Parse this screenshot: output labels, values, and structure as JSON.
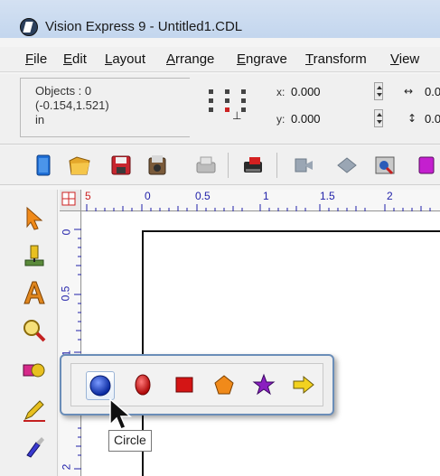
{
  "window": {
    "title": "Vision Express 9 - Untitled1.CDL"
  },
  "menu": {
    "items": [
      {
        "mnemonic": "F",
        "rest": "ile"
      },
      {
        "mnemonic": "E",
        "rest": "dit"
      },
      {
        "mnemonic": "L",
        "rest": "ayout"
      },
      {
        "mnemonic": "A",
        "rest": "rrange"
      },
      {
        "mnemonic": "E",
        "rest": "ngrave"
      },
      {
        "mnemonic": "T",
        "rest": "ransform"
      },
      {
        "mnemonic": "V",
        "rest": "iew"
      }
    ]
  },
  "property_bar": {
    "objects_label": "Objects : 0",
    "coords": "(-0.154,1.521)",
    "units": "in",
    "x_label": "x:",
    "x_value": "0.000",
    "y_label": "y:",
    "y_value": "0.000",
    "width_value": "0.0",
    "height_value": "0.0"
  },
  "toolbar": {
    "icons": [
      "new-icon",
      "open-icon",
      "save-icon",
      "import-icon",
      "print-icon",
      "engrave-output-icon",
      "undo-icon",
      "redo-icon",
      "zoom-page-icon",
      "color-icon"
    ]
  },
  "ruler": {
    "top_labels": [
      "5",
      "0",
      "0.5",
      "1",
      "1.5",
      "2"
    ],
    "left_labels": [
      "0",
      "0.5",
      "1",
      "2"
    ]
  },
  "toolbox": {
    "tools": [
      "select-tool-icon",
      "engrave-tool-icon",
      "text-tool-icon",
      "zoom-tool-icon",
      "shapes-tool-icon",
      "pencil-tool-icon",
      "brush-tool-icon"
    ]
  },
  "flyout": {
    "shapes": [
      "circle-shape",
      "ellipse-shape",
      "rectangle-shape",
      "polygon-shape",
      "star-shape",
      "arrow-shape"
    ],
    "tooltip": "Circle"
  },
  "colors": {
    "title_bar": "#c3d6ee",
    "flyout_border": "#6a8db8",
    "circle_blue": "#1d3fb8",
    "shape_red": "#d41515",
    "polygon_orange": "#f08a1a",
    "star_purple": "#8a1fc0",
    "arrow_yellow": "#f2d21f"
  }
}
